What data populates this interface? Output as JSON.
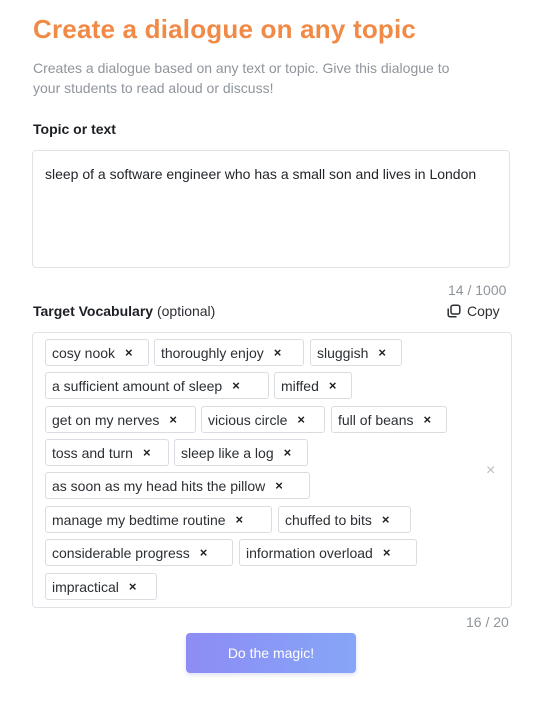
{
  "header": {
    "title": "Create a dialogue on any topic",
    "subtitle": "Creates a dialogue based on any text or topic. Give this dialogue to your students to read aloud or discuss!"
  },
  "topic": {
    "label": "Topic or text",
    "value": "sleep of a software engineer who has a small son and lives in London",
    "counter": "14 / 1000"
  },
  "vocabulary": {
    "label": "Target Vocabulary",
    "optional": "(optional)",
    "copy_label": "Copy",
    "copy_icon": "copy-icon",
    "tags": [
      "cosy nook",
      "thoroughly enjoy",
      "sluggish",
      "a sufficient amount of sleep",
      "miffed",
      "get on my nerves",
      "vicious circle",
      "full of beans",
      "toss and turn",
      "sleep like a log",
      "as soon as my head hits the pillow",
      "manage my bedtime routine",
      "chuffed to bits",
      "considerable progress",
      "information overload",
      "impractical"
    ],
    "remove_glyph": "×",
    "clear_glyph": "×",
    "counter": "16 / 20"
  },
  "action": {
    "button_label": "Do the magic!"
  },
  "colors": {
    "title": "#f08a46",
    "button_start": "#8d8cf4",
    "button_end": "#86a6f7"
  }
}
